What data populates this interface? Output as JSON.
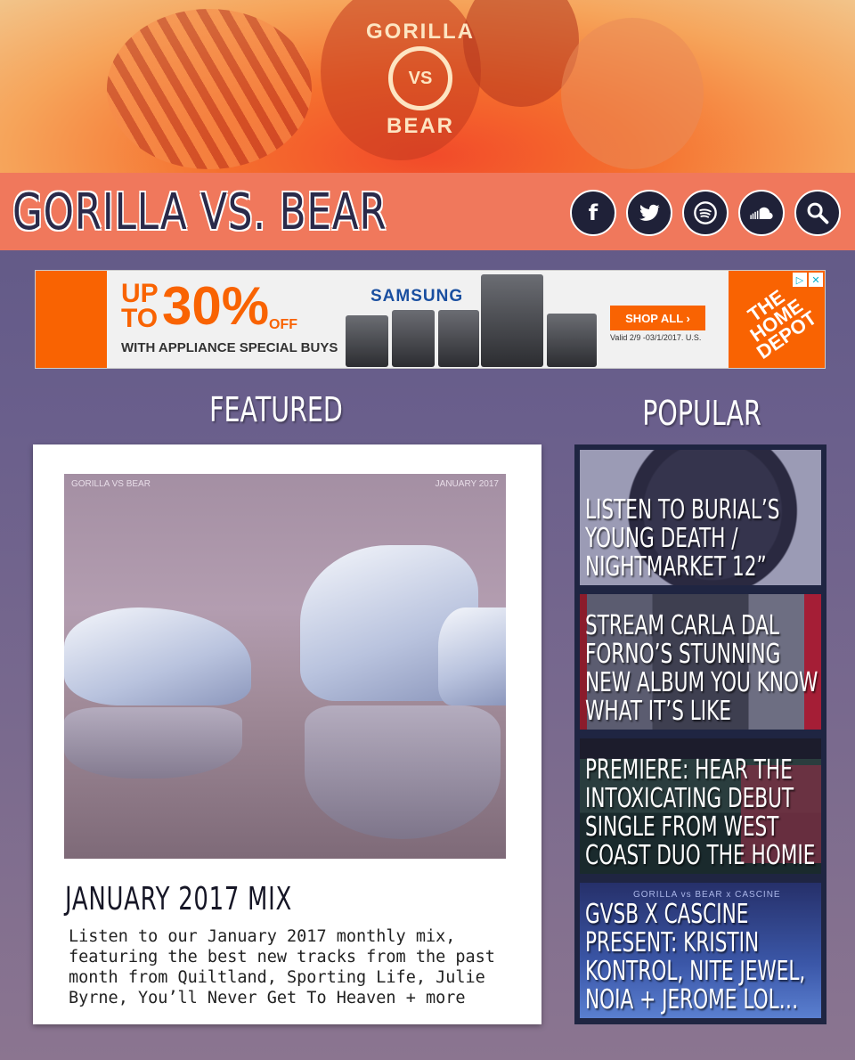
{
  "hero": {
    "logo_top": "GORILLA",
    "logo_mid": "VS",
    "logo_bottom": "BEAR"
  },
  "header": {
    "site_title": "GORILLA VS. BEAR",
    "social": [
      {
        "icon": "facebook-icon",
        "glyph": "f"
      },
      {
        "icon": "twitter-icon",
        "glyph": ""
      },
      {
        "icon": "spotify-icon",
        "glyph": ""
      },
      {
        "icon": "soundcloud-icon",
        "glyph": ""
      },
      {
        "icon": "search-icon",
        "glyph": ""
      }
    ]
  },
  "ad": {
    "up_to": "UP TO",
    "percent": "30%",
    "off": "OFF",
    "subline": "WITH APPLIANCE SPECIAL BUYS",
    "brand": "SAMSUNG",
    "cta": "SHOP ALL ›",
    "valid": "Valid 2/9 -03/1/2017. U.S.",
    "retailer": "THE HOME DEPOT",
    "adchoices": "▷",
    "close": "✕"
  },
  "featured": {
    "heading": "FEATURED",
    "image_label_left": "GORILLA VS BEAR",
    "image_label_right": "JANUARY 2017",
    "title": "JANUARY 2017 MIX",
    "description": "Listen to our January 2017 monthly mix, featuring the best new tracks from the past month from Quiltland, Sporting Life, Julie Byrne, You’ll Never Get To Heaven + more"
  },
  "popular": {
    "heading": "POPULAR",
    "items": [
      {
        "title": "LISTEN TO BURIAL’S YOUNG DEATH / NIGHTMARKET 12”"
      },
      {
        "title": "STREAM CARLA DAL FORNO’S STUNNING NEW ALBUM YOU KNOW WHAT IT’S LIKE"
      },
      {
        "title": "PREMIERE: HEAR THE INTOXICATING DEBUT SINGLE FROM WEST COAST DUO THE HOMIE"
      },
      {
        "title": "GVSB X CASCINE PRESENT: KRISTIN KONTROL, NITE JEWEL, NOIA + JEROME LOL…",
        "image_tag": "GORILLA vs BEAR x CASCINE"
      }
    ]
  },
  "colors": {
    "header_bar": "#f0785c",
    "icon_bg": "#1f2138",
    "popular_bg": "#1f2542",
    "ad_orange": "#f96302"
  }
}
